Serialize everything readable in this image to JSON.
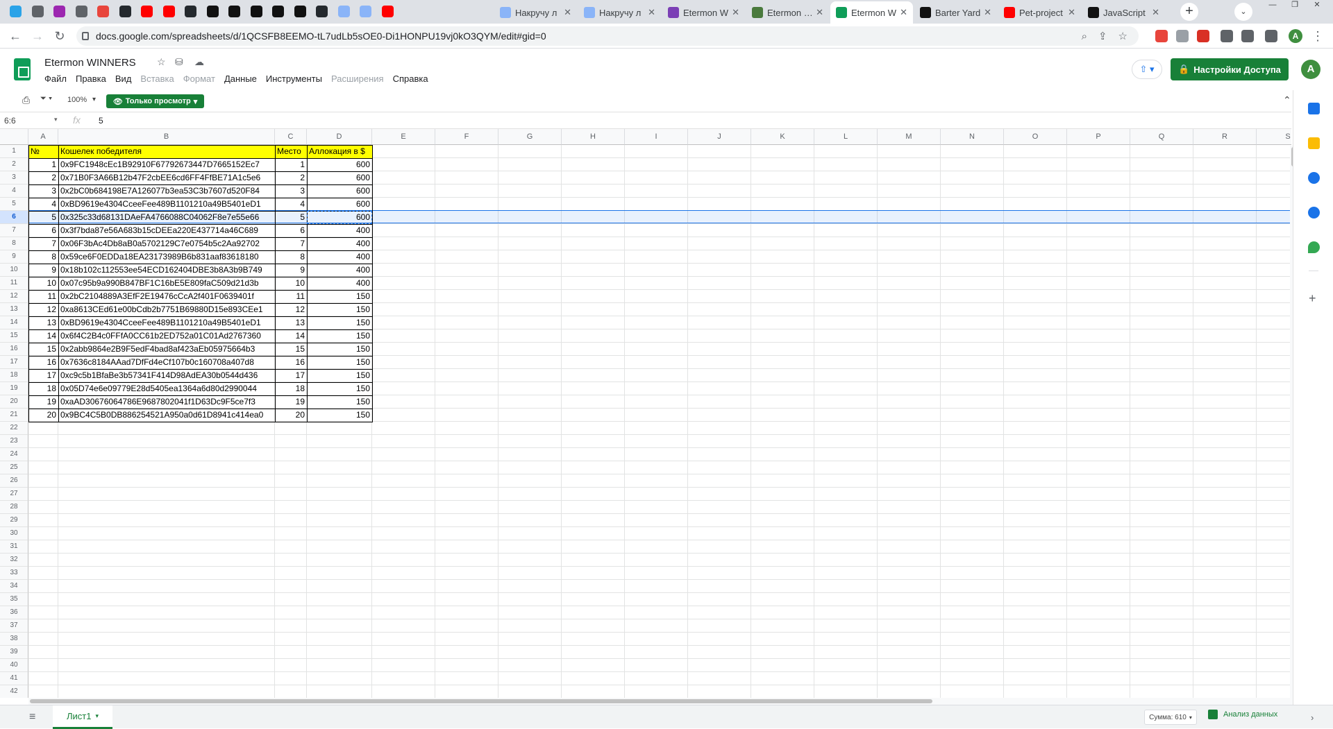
{
  "browser": {
    "tabs": [
      {
        "title": "Накручу л",
        "color": "#8ab4f8"
      },
      {
        "title": "Накручу л",
        "color": "#8ab4f8"
      },
      {
        "title": "Etermon W",
        "color": "#7b3fb5"
      },
      {
        "title": "Etermon | P",
        "color": "#4a7a3d"
      },
      {
        "title": "Etermon W",
        "color": "#0f9d58",
        "active": true
      },
      {
        "title": "Barter Yard",
        "color": "#111111"
      },
      {
        "title": "Pet-project",
        "color": "#ff0000"
      },
      {
        "title": "JavaScript",
        "color": "#111111"
      }
    ],
    "pinned_colors": [
      "#2aa3e8",
      "#5f6368",
      "#9c27b0",
      "#5f6368",
      "#e8453c",
      "#24292e",
      "#ff0000",
      "#ff0000",
      "#24292e",
      "#111111",
      "#111111",
      "#111111",
      "#111111",
      "#111111",
      "#24292e",
      "#8ab4f8",
      "#8ab4f8",
      "#ff0000"
    ],
    "close_glyph": "✕",
    "new_tab_glyph": "+",
    "tab_menu_glyph": "⌄",
    "window_controls": [
      "—",
      "❐",
      "✕"
    ],
    "url": "docs.google.com/spreadsheets/d/1QCSFB8EEMO-tL7udLb5sOE0-Di1HONPU19vj0kO3QYM/edit#gid=0",
    "nav": {
      "back": "←",
      "forward": "→",
      "reload": "↻"
    },
    "omnibox_icons": [
      "⌕",
      "⇪",
      "☆"
    ],
    "extension_colors": [
      "#e8453c",
      "#9aa0a6",
      "#d93025",
      "#5f6368",
      "#5f6368",
      "#5f6368"
    ],
    "profile_initial": "A"
  },
  "doc": {
    "title": "Etermon WINNERS",
    "star_icon": "☆",
    "move_icon": "⛁",
    "cloud_icon": "☁",
    "menu": [
      {
        "label": "Файл",
        "disabled": false
      },
      {
        "label": "Правка",
        "disabled": false
      },
      {
        "label": "Вид",
        "disabled": false
      },
      {
        "label": "Вставка",
        "disabled": true
      },
      {
        "label": "Формат",
        "disabled": true
      },
      {
        "label": "Данные",
        "disabled": false
      },
      {
        "label": "Инструменты",
        "disabled": false
      },
      {
        "label": "Расширения",
        "disabled": true
      },
      {
        "label": "Справка",
        "disabled": false
      }
    ],
    "present_label": "⇧ ▾",
    "share_icon": "🔒",
    "share_label": "Настройки Доступа",
    "account_initial": "A"
  },
  "toolbar": {
    "print_icon": "⎙",
    "filter_icon": "⏷ ▾",
    "zoom": "100%",
    "zoom_arrow": "▾",
    "view_only_icon": "👁",
    "view_only_label": "Только просмотр",
    "view_only_arrow": "▾",
    "collapse_icon": "⌃"
  },
  "formula_bar": {
    "name_box": "6:6",
    "name_arrow": "▾",
    "fx": "fx",
    "value": "5"
  },
  "sheet": {
    "columns": [
      "A",
      "B",
      "C",
      "D",
      "E",
      "F",
      "G",
      "H",
      "I",
      "J",
      "K",
      "L",
      "M",
      "N",
      "O",
      "P",
      "Q",
      "R",
      "S"
    ],
    "row_numbers": [
      "1",
      "2",
      "3",
      "4",
      "5",
      "6",
      "7",
      "8",
      "9",
      "10",
      "11",
      "12",
      "13",
      "14",
      "15",
      "16",
      "17",
      "18",
      "19",
      "20",
      "21",
      "22",
      "23",
      "24",
      "25",
      "26",
      "27",
      "28",
      "29",
      "30",
      "31",
      "32",
      "33",
      "34",
      "35",
      "36",
      "37",
      "38",
      "39",
      "40",
      "41",
      "42"
    ],
    "selected_row": 6,
    "header": [
      "№",
      "Кошелек победителя",
      "Место",
      "Аллокация в $"
    ],
    "rows": [
      [
        "1",
        "0x9FC1948cEc1B92910F67792673447D7665152Ec7",
        "1",
        "600"
      ],
      [
        "2",
        "0x71B0F3A66B12b47F2cbEE6cd6FF4FfBE71A1c5e6",
        "2",
        "600"
      ],
      [
        "3",
        "0x2bC0b684198E7A126077b3ea53C3b7607d520F84",
        "3",
        "600"
      ],
      [
        "4",
        "0xBD9619e4304CceeFee489B1101210a49B5401eD1",
        "4",
        "600"
      ],
      [
        "5",
        "0x325c33d68131DAeFA4766088C04062F8e7e55e66",
        "5",
        "600"
      ],
      [
        "6",
        "0x3f7bda87e56A683b15cDEEa220E437714a46C689",
        "6",
        "400"
      ],
      [
        "7",
        "0x06F3bAc4Db8aB0a5702129C7e0754b5c2Aa92702",
        "7",
        "400"
      ],
      [
        "8",
        "0x59ce6F0EDDa18EA23173989B6b831aaf83618180",
        "8",
        "400"
      ],
      [
        "9",
        "0x18b102c112553ee54ECD162404DBE3b8A3b9B749",
        "9",
        "400"
      ],
      [
        "10",
        "0x07c95b9a990B847BF1C16bE5E809faC509d21d3b",
        "10",
        "400"
      ],
      [
        "11",
        "0x2bC2104889A3EfF2E19476cCcA2f401F0639401f",
        "11",
        "150"
      ],
      [
        "12",
        "0xa8613CEd61e00bCdb2b7751B69880D15e893CEe1",
        "12",
        "150"
      ],
      [
        "13",
        "0xBD9619e4304CceeFee489B1101210a49B5401eD1",
        "13",
        "150"
      ],
      [
        "14",
        "0x6f4C2B4c0FFfA0CC61b2ED752a01C01Ad2767360",
        "14",
        "150"
      ],
      [
        "15",
        "0x2abb9864e2B9F5edF4bad8af423aEb05975664b3",
        "15",
        "150"
      ],
      [
        "16",
        "0x7636c8184AAad7DfFd4eCf107b0c160708a407d8",
        "16",
        "150"
      ],
      [
        "17",
        "0xc9c5b1BfaBe3b57341F414D98AdEA30b0544d436",
        "17",
        "150"
      ],
      [
        "18",
        "0x05D74e6e09779E28d5405ea1364a6d80d2990044",
        "18",
        "150"
      ],
      [
        "19",
        "0xaAD30676064786E9687802041f1D63Dc9F5ce7f3",
        "19",
        "150"
      ],
      [
        "20",
        "0x9BC4C5B0DB886254521A950a0d61D8941c414ea0",
        "20",
        "150"
      ]
    ],
    "header_fill": "#ffff00"
  },
  "side_panel": {
    "icons": [
      {
        "name": "calendar",
        "color": "#1a73e8"
      },
      {
        "name": "keep",
        "color": "#fbbc04"
      },
      {
        "name": "tasks",
        "color": "#1a73e8"
      },
      {
        "name": "contacts",
        "color": "#1a73e8"
      },
      {
        "name": "maps",
        "color": "#34a853"
      }
    ],
    "add_glyph": "+",
    "expand_glyph": "›"
  },
  "bottom": {
    "all_sheets_icon": "≡",
    "sheet_name": "Лист1",
    "sheet_arrow": "▾",
    "sum_label": "Сумма: 610",
    "sum_arrow": "▾",
    "explore_label": "Анализ данных"
  }
}
